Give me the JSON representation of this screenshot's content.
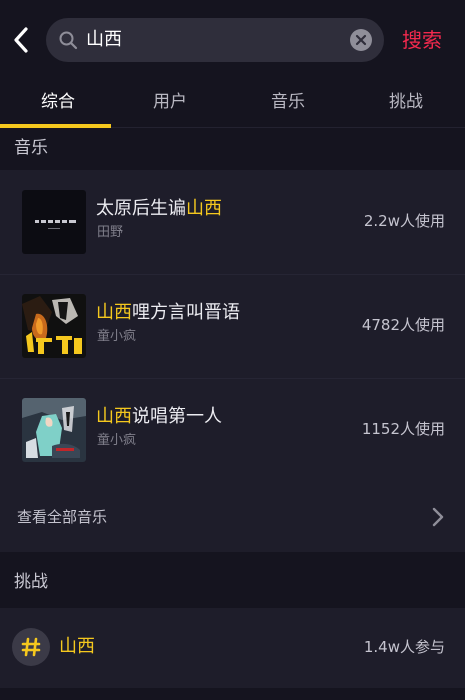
{
  "search": {
    "query": "山西",
    "button_label": "搜索"
  },
  "tabs": [
    {
      "label": "综合",
      "active": true
    },
    {
      "label": "用户",
      "active": false
    },
    {
      "label": "音乐",
      "active": false
    },
    {
      "label": "挑战",
      "active": false
    }
  ],
  "music_section": {
    "header": "音乐",
    "items": [
      {
        "title_pre": "太原后生谝",
        "title_hl": "山西",
        "title_post": "",
        "artist": "田野",
        "usage": "2.2w人使用"
      },
      {
        "title_pre": "",
        "title_hl": "山西",
        "title_post": "哩方言叫晋语",
        "artist": "童小疯",
        "usage": "4782人使用"
      },
      {
        "title_pre": "",
        "title_hl": "山西",
        "title_post": "说唱第一人",
        "artist": "童小疯",
        "usage": "1152人使用"
      }
    ],
    "see_all": "查看全部音乐"
  },
  "challenge_section": {
    "header": "挑战",
    "item": {
      "title": "山西",
      "usage": "1.4w人参与"
    }
  },
  "colors": {
    "background": "#15141f",
    "card": "#1e1d2a",
    "highlight": "#f5c81e",
    "search_button": "#f2294e"
  },
  "icons": [
    "back-arrow-icon",
    "search-icon",
    "clear-icon",
    "chevron-right-icon",
    "hashtag-icon"
  ]
}
